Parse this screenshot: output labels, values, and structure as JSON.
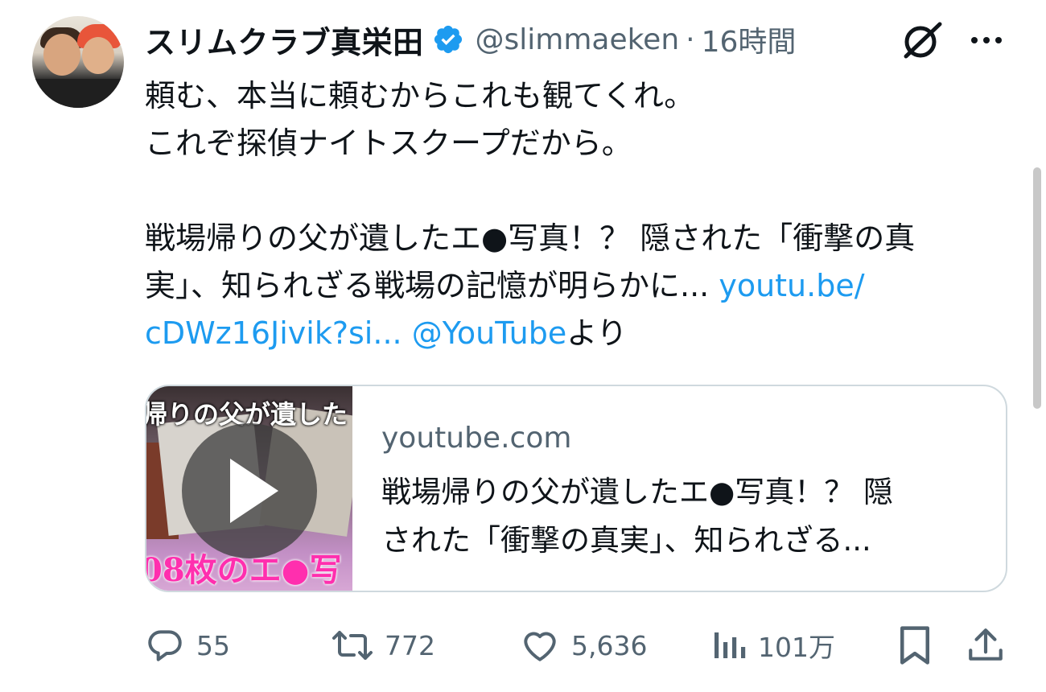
{
  "author": {
    "display_name": "スリムクラブ真栄田",
    "handle": "@slimmaeken",
    "separator": "·",
    "time": "16時間",
    "verified": true
  },
  "tweet": {
    "line1": "頼む、本当に頼むからこれも観てくれ。",
    "line2": "これぞ探偵ナイトスクープだから。",
    "line3": "戦場帰りの父が遺したエ●写真！？ 隠された「衝撃の真",
    "line4_text": "実」、知られざる戦場の記憶が明らかに... ",
    "line4_link": "youtu.be/",
    "line5_link": "cDWz16Jivik?si...",
    "line5_mention": "@YouTube",
    "line5_suffix": "より"
  },
  "card": {
    "domain": "youtube.com",
    "title_line1": "戦場帰りの父が遺したエ●写真！？ 隠",
    "title_line2": "された「衝撃の真実」、知られざる...",
    "thumb_top_text": "帰りの父が遺した",
    "thumb_bottom_text": "08枚のエ●写"
  },
  "actions": {
    "replies": "55",
    "retweets": "772",
    "likes": "5,636",
    "views": "101万"
  },
  "colors": {
    "link": "#1d9bf0",
    "verified": "#1d9bf0",
    "secondary_text": "#536471"
  },
  "icons": {
    "grok": "grok-icon",
    "more": "more-icon",
    "reply": "reply-icon",
    "retweet": "retweet-icon",
    "like": "heart-icon",
    "views": "views-icon",
    "bookmark": "bookmark-icon",
    "share": "share-icon"
  }
}
